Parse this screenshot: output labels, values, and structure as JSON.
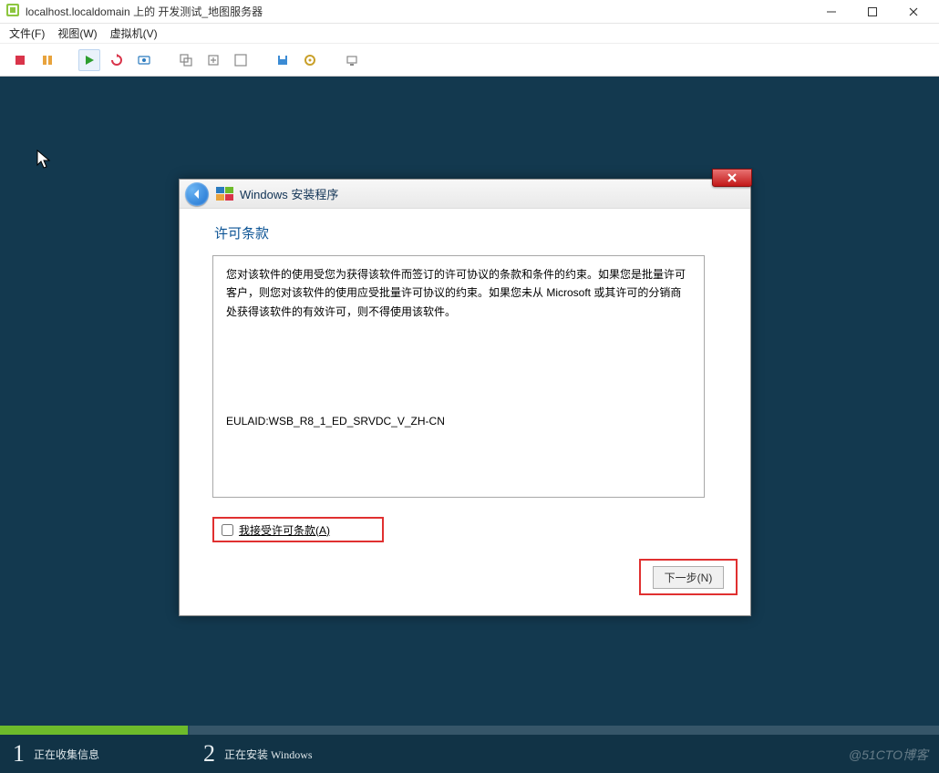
{
  "vmWindow": {
    "title": "localhost.localdomain 上的 开发测试_地图服务器",
    "controls": {
      "min": "—",
      "max": "□",
      "close": "✕"
    }
  },
  "menubar": {
    "file": "文件(F)",
    "view": "视图(W)",
    "vm": "虚拟机(V)"
  },
  "toolbar": {
    "icons": {
      "stop": "stop-icon",
      "pause": "pause-icon",
      "play": "play-icon",
      "reset": "reset-icon",
      "snapshot": "snapshot-icon",
      "snapMgr": "snapshot-manager-icon",
      "revert": "revert-icon",
      "fullscreen": "fullscreen-icon",
      "cad": "ctrl-alt-del-icon",
      "devices": "devices-icon",
      "tools": "tools-icon"
    }
  },
  "installer": {
    "headerTitle": "Windows 安装程序",
    "sectionTitle": "许可条款",
    "eulaText": "您对该软件的使用受您为获得该软件而签订的许可协议的条款和条件的约束。如果您是批量许可客户，则您对该软件的使用应受批量许可协议的约束。如果您未从 Microsoft 或其许可的分销商处获得该软件的有效许可，则不得使用该软件。",
    "eulaId": "EULAID:WSB_R8_1_ED_SRVDC_V_ZH-CN",
    "acceptLabel": "我接受许可条款(A)",
    "nextLabel": "下一步(N)"
  },
  "steps": {
    "s1num": "1",
    "s1label": "正在收集信息",
    "s2num": "2",
    "s2label": "正在安装 Windows"
  },
  "watermark": "@51CTO博客"
}
